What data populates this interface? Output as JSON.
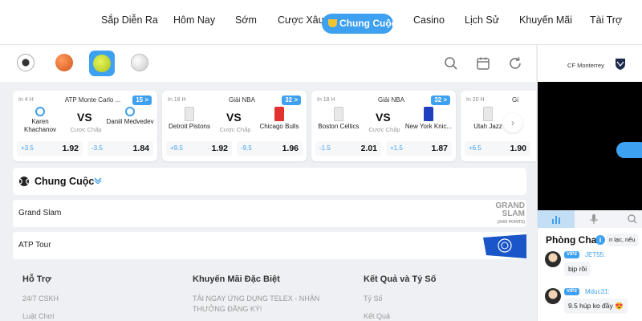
{
  "nav": {
    "items": [
      "Sắp Diễn Ra",
      "Hôm Nay",
      "Sớm",
      "Cược Xâu"
    ],
    "active": "Chung Cuộc",
    "items_after": [
      "Casino",
      "Lịch Sử",
      "Khuyến Mãi",
      "Tài Trợ"
    ]
  },
  "sports": [
    "soccer-ball-icon",
    "basketball-icon",
    "tennis-ball-icon",
    "baseball-icon"
  ],
  "cards": [
    {
      "time": "In 4 H",
      "league": "ATP Monte Carlo ...",
      "count": "15 >",
      "home": "Karen Khachanov",
      "away": "Daniil Medvedev",
      "vs": "VS",
      "market": "Cược Chấp",
      "home_hcp": "+3.5",
      "home_odd": "1.92",
      "away_hcp": "-3.5",
      "away_odd": "1.84"
    },
    {
      "time": "In 18 H",
      "league": "Giải NBA",
      "count": "32 >",
      "home": "Detroit Pistons",
      "away": "Chicago Bulls",
      "vs": "VS",
      "market": "Cược Chấp",
      "home_hcp": "+9.5",
      "home_odd": "1.92",
      "away_hcp": "-9.5",
      "away_odd": "1.96"
    },
    {
      "time": "In 18 H",
      "league": "Giải NBA",
      "count": "32 >",
      "home": "Boston Celtics",
      "away": "New York Knic...",
      "vs": "VS",
      "market": "Cược Chấp",
      "home_hcp": "-1.5",
      "home_odd": "2.01",
      "away_hcp": "+1.5",
      "away_odd": "1.87"
    },
    {
      "time": "In 20 H",
      "league": "Gi",
      "count": "",
      "home": "Utah Jazz",
      "away": "",
      "vs": "",
      "market": "",
      "home_hcp": "+6.5",
      "home_odd": "1.90",
      "away_hcp": "",
      "away_odd": ""
    }
  ],
  "section": {
    "title": "Chung Cuộc"
  },
  "rows": [
    {
      "name": "Grand Slam",
      "logo_text": "GRAND SLAM",
      "logo_sub": "(2000 POINTS)"
    },
    {
      "name": "ATP Tour"
    }
  ],
  "footer": {
    "cols": [
      {
        "title": "Hỗ Trợ",
        "items": [
          "24/7 CSKH",
          "Luật Chơi"
        ]
      },
      {
        "title": "Khuyến Mãi Đặc Biệt",
        "items": [
          "TẢI NGAY ỨNG DỤNG TELEX - NHẬN THƯỞNG ĐĂNG KÝ!"
        ]
      },
      {
        "title": "Kết Quả và Tỷ Số",
        "items": [
          "Tỷ Số",
          "Kết Quả"
        ]
      }
    ]
  },
  "side": {
    "team": "CF Monterrey",
    "chat_title": "Phòng Chat",
    "chat_snippet": "n lạc, nếu",
    "messages": [
      {
        "badge": "VIP2",
        "user": "JET55:",
        "text": "bịp rồi"
      },
      {
        "badge": "VIP2",
        "user": "Mduc31:",
        "text": "9.5 húp ko đầy 😍"
      }
    ]
  },
  "colors": {
    "accent": "#3ea0f0",
    "background": "#eef0f4"
  }
}
